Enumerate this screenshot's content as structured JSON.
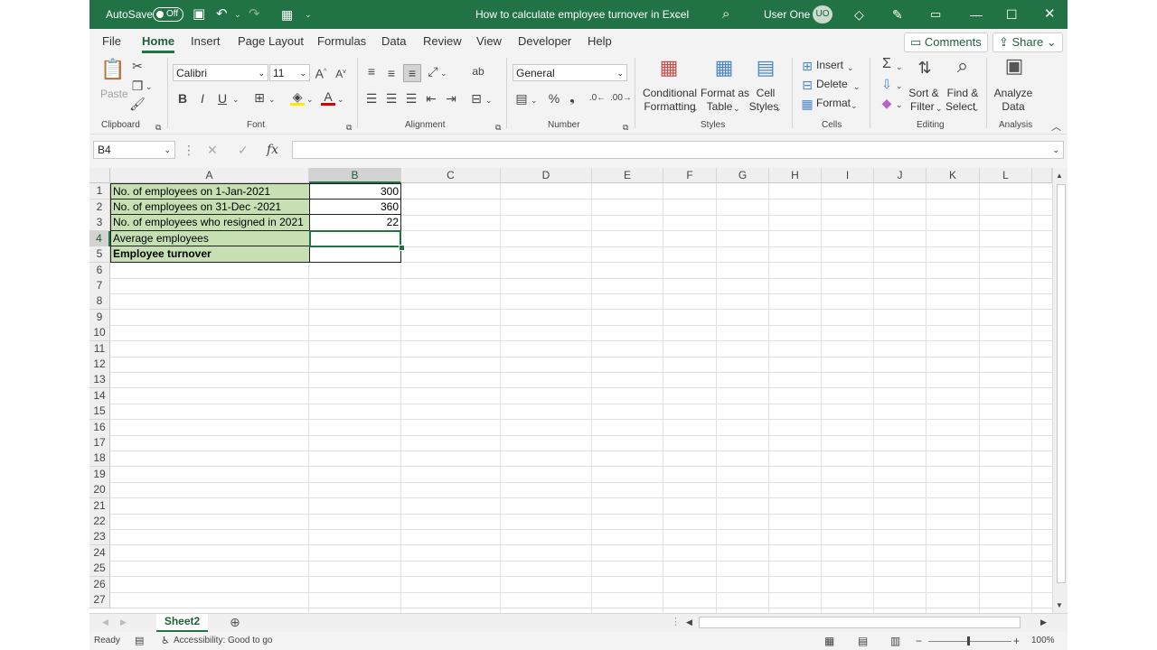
{
  "titlebar": {
    "autosave_label": "AutoSave",
    "autosave_state": "Off",
    "doc_title": "How to calculate employee turnover in Excel",
    "user_name": "User One",
    "user_initials": "UO"
  },
  "menu": {
    "tabs": [
      "File",
      "Home",
      "Insert",
      "Page Layout",
      "Formulas",
      "Data",
      "Review",
      "View",
      "Developer",
      "Help"
    ],
    "active": "Home",
    "comments": "Comments",
    "share": "Share"
  },
  "ribbon": {
    "clipboard": {
      "paste": "Paste",
      "label": "Clipboard"
    },
    "font": {
      "name": "Calibri",
      "size": "11",
      "label": "Font"
    },
    "alignment": {
      "label": "Alignment"
    },
    "number": {
      "format": "General",
      "label": "Number"
    },
    "styles": {
      "conditional_1": "Conditional",
      "conditional_2": "Formatting",
      "format_table_1": "Format as",
      "format_table_2": "Table",
      "cell_styles_1": "Cell",
      "cell_styles_2": "Styles",
      "label": "Styles"
    },
    "cells": {
      "insert": "Insert",
      "delete": "Delete",
      "format": "Format",
      "label": "Cells"
    },
    "editing": {
      "sort_1": "Sort &",
      "sort_2": "Filter",
      "find_1": "Find &",
      "find_2": "Select",
      "label": "Editing"
    },
    "analysis": {
      "analyze_1": "Analyze",
      "analyze_2": "Data",
      "label": "Analysis"
    }
  },
  "formula_bar": {
    "name_box": "B4",
    "fx": "fx",
    "value": ""
  },
  "columns": [
    "A",
    "B",
    "C",
    "D",
    "E",
    "F",
    "G",
    "H",
    "I",
    "J",
    "K",
    "L"
  ],
  "rows": [
    "1",
    "2",
    "3",
    "4",
    "5",
    "6",
    "7",
    "8",
    "9",
    "10",
    "11",
    "12",
    "13",
    "14",
    "15",
    "16",
    "17",
    "18",
    "19",
    "20",
    "21",
    "22",
    "23",
    "24",
    "25",
    "26",
    "27"
  ],
  "cells": {
    "A1": "No. of employees on 1-Jan-2021",
    "A2": "No. of employees on 31-Dec -2021",
    "A3": "No. of employees who resigned in 2021",
    "A4": "Average employees",
    "A5": "Employee turnover",
    "B1": "300",
    "B2": "360",
    "B3": "22",
    "B4": "",
    "B5": ""
  },
  "selected_cell": "B4",
  "sheets": [
    "Sheet2"
  ],
  "status": {
    "ready": "Ready",
    "accessibility": "Accessibility: Good to go",
    "zoom": "100%"
  },
  "colors": {
    "excel_green": "#217346",
    "header_fill": "#c6e0b4"
  }
}
